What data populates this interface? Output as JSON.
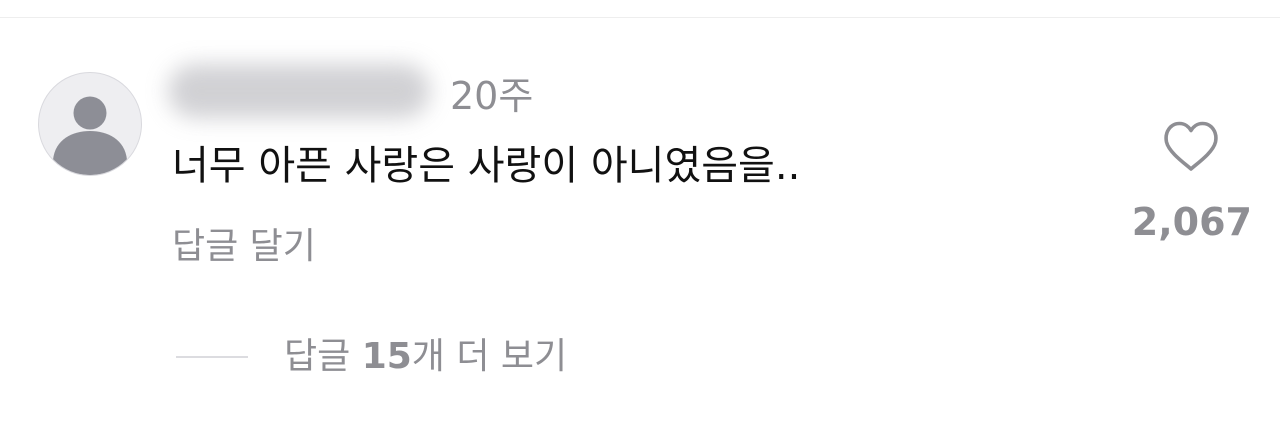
{
  "comment": {
    "avatar_icon": "default-user-icon",
    "username": "",
    "timestamp": "20주",
    "text": "너무 아픈 사랑은 사랑이 아니였음을..",
    "reply_label": "답글 달기",
    "like_icon": "heart-outline-icon",
    "like_count": "2,067"
  },
  "replies": {
    "prefix": "답글 ",
    "count": "15",
    "suffix": "개 더 보기"
  },
  "colors": {
    "text_primary": "#111111",
    "text_secondary": "#8e8e93",
    "divider": "#eeeeee"
  }
}
